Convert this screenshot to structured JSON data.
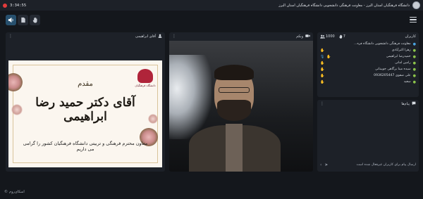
{
  "topbar": {
    "timer": "3:34:55",
    "room_title": "دانشگاه فرهنگیان استان البرز - معاونت فرهنگی دانشجویی دانشگاه فرهنگیان استان البرز"
  },
  "toolbar": {
    "tools": [
      "speaker-icon",
      "file-icon",
      "hand-icon"
    ]
  },
  "presenter_panel": {
    "title": "آقای ابراهیمی",
    "slide": {
      "heading": "مقدم",
      "name": "آقای دکتر حمید رضا ابراهیمی",
      "subtitle": "معاون محترم فرهنگی و تربیتی دانشگاه فرهنگیان کشور را گرامی می داریم",
      "logo_caption": "دانشگاه فرهنگیان"
    }
  },
  "video_panel": {
    "title": "وبکم"
  },
  "users_panel": {
    "title": "کاربران",
    "count_users": "7",
    "count_total": "1000",
    "users": [
      {
        "name": "معاونت فرهنگی دانشجویی دانشگاه فره...",
        "role": "moderator",
        "hand": false,
        "mic": false
      },
      {
        "name": "زهرا اکبرآبادی",
        "role": "user",
        "hand": true,
        "mic": false
      },
      {
        "name": "حمیدرضا ابراهیمی",
        "role": "user",
        "hand": true,
        "mic": true
      },
      {
        "name": "رامین امانی",
        "role": "user",
        "hand": true,
        "mic": false
      },
      {
        "name": "سیده مینا برگاهی جویبناتی",
        "role": "user",
        "hand": true,
        "mic": false
      },
      {
        "name": "علی صفوی 0936205447",
        "role": "user",
        "hand": true,
        "mic": false
      },
      {
        "name": "سعید",
        "role": "user",
        "hand": true,
        "mic": false
      }
    ]
  },
  "chat_panel": {
    "title": "پیام‌ها",
    "input_placeholder": "ارسال پیام برای کاربران غیرفعال شده است"
  },
  "footer": {
    "label": "اسکای‌روم"
  },
  "colors": {
    "background": "#14171c",
    "panel": "#1d2128",
    "accent": "#27506e",
    "recording": "#e23b3b"
  }
}
